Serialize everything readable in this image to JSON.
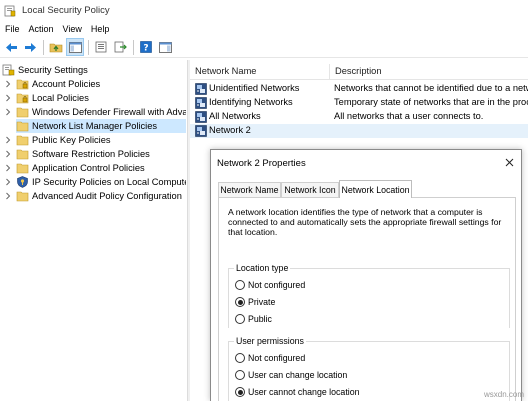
{
  "window": {
    "title": "Local Security Policy"
  },
  "menu": [
    "File",
    "Action",
    "View",
    "Help"
  ],
  "tree": {
    "root": "Security Settings",
    "items": [
      {
        "label": "Account Policies",
        "icon": "folder-lock-icon"
      },
      {
        "label": "Local Policies",
        "icon": "folder-lock-icon"
      },
      {
        "label": "Windows Defender Firewall with Adva",
        "icon": "folder-icon"
      },
      {
        "label": "Network List Manager Policies",
        "icon": "folder-icon",
        "selected": true
      },
      {
        "label": "Public Key Policies",
        "icon": "folder-icon"
      },
      {
        "label": "Software Restriction Policies",
        "icon": "folder-icon"
      },
      {
        "label": "Application Control Policies",
        "icon": "folder-icon"
      },
      {
        "label": "IP Security Policies on Local Compute",
        "icon": "shield-key-icon"
      },
      {
        "label": "Advanced Audit Policy Configuration",
        "icon": "folder-icon"
      }
    ]
  },
  "list": {
    "columns": [
      "Network Name",
      "Description"
    ],
    "rows": [
      {
        "name": "Unidentified Networks",
        "desc": "Networks that cannot be identified due to a netw"
      },
      {
        "name": "Identifying Networks",
        "desc": "Temporary state of networks that are in the proc"
      },
      {
        "name": "All Networks",
        "desc": "All networks that a user connects to."
      },
      {
        "name": "Network 2",
        "desc": ""
      }
    ]
  },
  "dialog": {
    "title": "Network 2 Properties",
    "tabs": [
      "Network Name",
      "Network Icon",
      "Network Location"
    ],
    "active_tab": "Network Location",
    "intro": "A network location identifies the type of network that a computer is connected to and automatically sets the appropriate firewall settings for that location.",
    "location_type": {
      "legend": "Location type",
      "options": [
        "Not configured",
        "Private",
        "Public"
      ],
      "selected": "Private"
    },
    "user_permissions": {
      "legend": "User permissions",
      "options": [
        "Not configured",
        "User can change location",
        "User cannot change location"
      ],
      "selected": "User cannot change location"
    }
  },
  "watermark": "wsxdn.com",
  "colors": {
    "selection": "#cde8ff",
    "list_selection": "#e5f1fb",
    "accent": "#0078d7"
  }
}
